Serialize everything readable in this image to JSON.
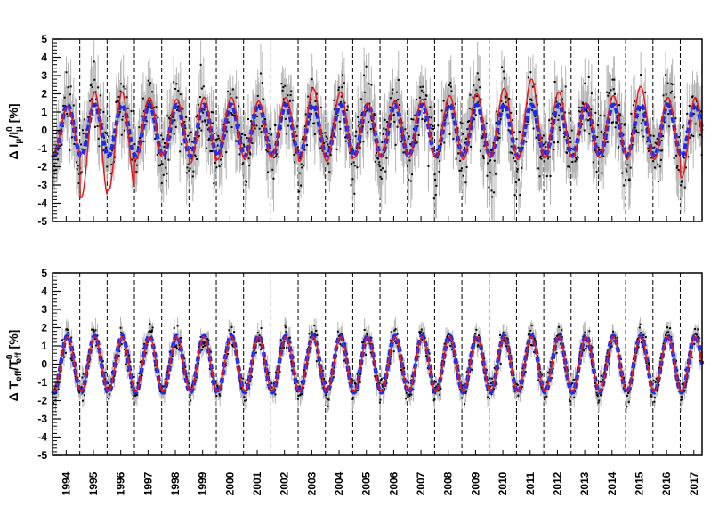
{
  "chart_data": [
    {
      "id": "top",
      "type": "line",
      "ylabel": {
        "main": "Δ I",
        "sub1": "μ",
        "mid": "/I",
        "sup": "0",
        "sub2": "μ",
        "tail": " [%]"
      },
      "ylim": [
        -5,
        5
      ],
      "yticks": [
        "5",
        "4",
        "3",
        "2",
        "1",
        "0",
        "-1",
        "-2",
        "-3",
        "-4",
        "-5"
      ],
      "xlim": [
        1994.0,
        2017.8
      ],
      "grid": false,
      "series": [
        {
          "role": "data",
          "color": "#000000",
          "error_color": "#b4b4b4",
          "amplitude": 1.5,
          "noise": 1.1,
          "error": 1.2
        },
        {
          "role": "fit",
          "color": "#e8181d",
          "style": "solid",
          "amplitude": [
            1.3,
            2.9,
            2.7,
            1.7,
            1.5,
            1.8,
            1.7,
            1.6,
            1.6,
            2.0,
            1.9,
            1.5,
            1.5,
            1.6,
            1.7,
            1.8,
            1.9,
            2.2,
            1.8,
            1.5,
            1.7,
            2.0,
            1.7,
            2.2,
            2.2
          ],
          "offset": [
            0.0,
            -0.8,
            -0.6,
            0.1,
            0.2,
            0.0,
            0.1,
            0.0,
            0.2,
            0.3,
            0.2,
            0.0,
            0.1,
            0.1,
            0.2,
            0.2,
            0.4,
            0.6,
            0.3,
            0.0,
            0.2,
            0.4,
            0.1,
            -0.4,
            -0.3
          ]
        },
        {
          "role": "model",
          "color": "#1a2bf0",
          "style": "dashed",
          "amplitude": 1.4,
          "offset": 0.0
        }
      ]
    },
    {
      "id": "bottom",
      "type": "line",
      "ylabel": {
        "main": "Δ T",
        "sub1": "eff",
        "mid": "/T",
        "sup": "0",
        "sub2": "eff",
        "tail": " [%]"
      },
      "ylim": [
        -5,
        5
      ],
      "yticks": [
        "5",
        "4",
        "3",
        "2",
        "1",
        "0",
        "-1",
        "-2",
        "-3",
        "-4",
        "-5"
      ],
      "xlim": [
        1994.0,
        2017.8
      ],
      "grid": false,
      "series": [
        {
          "role": "data",
          "color": "#000000",
          "error_color": "#b4b4b4",
          "amplitude": 1.5,
          "noise": 0.45,
          "error": 0.45
        },
        {
          "role": "fit",
          "color": "#e8181d",
          "style": "solid",
          "amplitude": 1.5,
          "offset": 0.0
        },
        {
          "role": "model",
          "color": "#1a2bf0",
          "style": "dashed",
          "amplitude": 1.55,
          "offset": 0.0
        }
      ]
    }
  ],
  "x_axis": {
    "years": [
      "1994",
      "1995",
      "1996",
      "1997",
      "1998",
      "1999",
      "2000",
      "2001",
      "2002",
      "2003",
      "2004",
      "2005",
      "2006",
      "2007",
      "2008",
      "2009",
      "2010",
      "2011",
      "2012",
      "2013",
      "2014",
      "2015",
      "2016",
      "2017"
    ],
    "year_dividers": [
      1995,
      1996,
      1997,
      1998,
      1999,
      2000,
      2001,
      2002,
      2003,
      2004,
      2005,
      2006,
      2007,
      2008,
      2009,
      2010,
      2011,
      2012,
      2013,
      2014,
      2015,
      2016,
      2017
    ]
  }
}
